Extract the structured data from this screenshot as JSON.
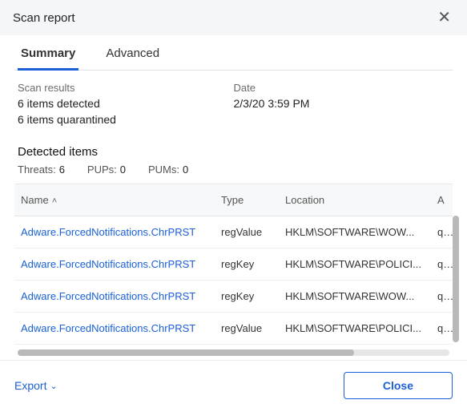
{
  "header": {
    "title": "Scan report"
  },
  "tabs": {
    "summary": "Summary",
    "advanced": "Advanced"
  },
  "info": {
    "results_label": "Scan results",
    "detected": "6 items detected",
    "quarantined": "6 items quarantined",
    "date_label": "Date",
    "date_value": "2/3/20 3:59 PM"
  },
  "section": {
    "detected_title": "Detected items"
  },
  "counts": {
    "threats_label": "Threats:",
    "threats_value": "6",
    "pups_label": "PUPs:",
    "pups_value": "0",
    "pums_label": "PUMs:",
    "pums_value": "0"
  },
  "columns": {
    "name": "Name",
    "type": "Type",
    "location": "Location",
    "action": "A"
  },
  "rows": [
    {
      "name": "Adware.ForcedNotifications.ChrPRST",
      "type": "regValue",
      "location": "HKLM\\SOFTWARE\\WOW...",
      "action": "qu"
    },
    {
      "name": "Adware.ForcedNotifications.ChrPRST",
      "type": "regKey",
      "location": "HKLM\\SOFTWARE\\POLICI...",
      "action": "qu"
    },
    {
      "name": "Adware.ForcedNotifications.ChrPRST",
      "type": "regKey",
      "location": "HKLM\\SOFTWARE\\WOW...",
      "action": "qu"
    },
    {
      "name": "Adware.ForcedNotifications.ChrPRST",
      "type": "regValue",
      "location": "HKLM\\SOFTWARE\\POLICI...",
      "action": "qu"
    }
  ],
  "footer": {
    "export": "Export",
    "close": "Close"
  }
}
